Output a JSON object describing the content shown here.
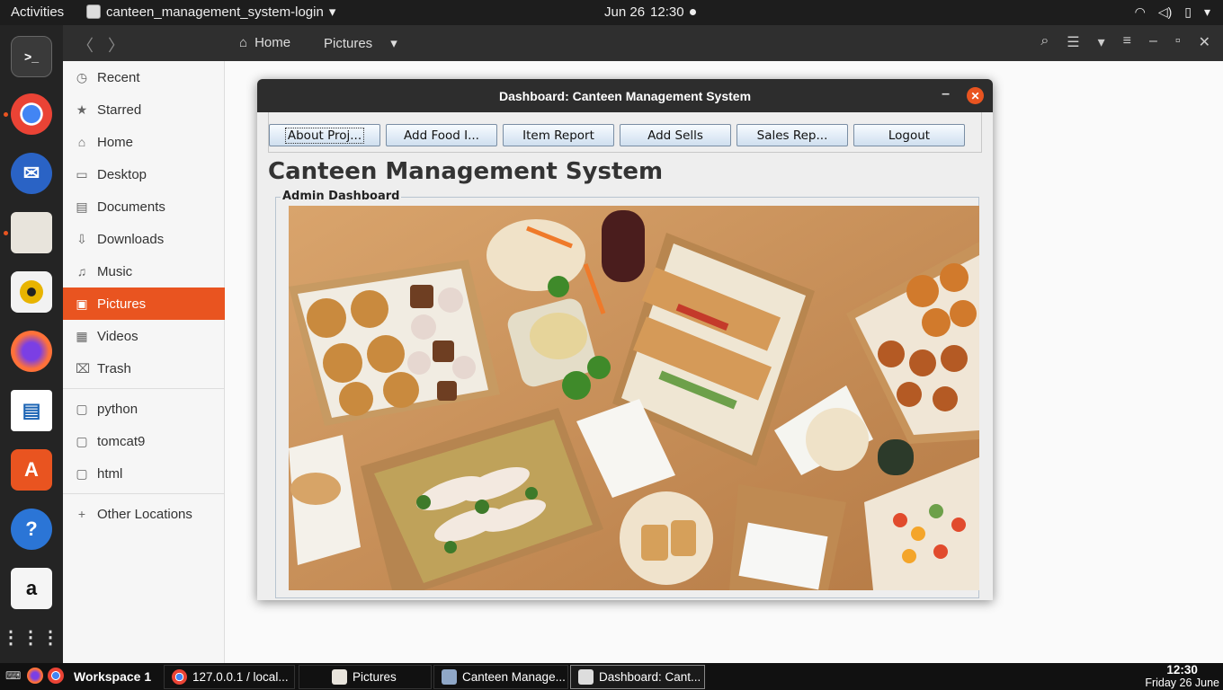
{
  "topbar": {
    "activities": "Activities",
    "app_name": "canteen_management_system-login",
    "date": "Jun 26",
    "time": "12:30"
  },
  "files": {
    "crumbs": [
      "Home",
      "Pictures"
    ],
    "sidebar": [
      {
        "label": "Recent",
        "icon": "clock-icon",
        "glyph": "◷"
      },
      {
        "label": "Starred",
        "icon": "star-icon",
        "glyph": "★"
      },
      {
        "label": "Home",
        "icon": "home-icon",
        "glyph": "⌂"
      },
      {
        "label": "Desktop",
        "icon": "desktop-icon",
        "glyph": "▭"
      },
      {
        "label": "Documents",
        "icon": "document-icon",
        "glyph": "▤"
      },
      {
        "label": "Downloads",
        "icon": "download-icon",
        "glyph": "⇩"
      },
      {
        "label": "Music",
        "icon": "music-icon",
        "glyph": "♫"
      },
      {
        "label": "Pictures",
        "icon": "picture-icon",
        "glyph": "▣",
        "active": true
      },
      {
        "label": "Videos",
        "icon": "video-icon",
        "glyph": "▦"
      },
      {
        "label": "Trash",
        "icon": "trash-icon",
        "glyph": "🗑"
      }
    ],
    "bookmarks": [
      {
        "label": "python",
        "icon": "folder-icon",
        "glyph": "▢"
      },
      {
        "label": "tomcat9",
        "icon": "folder-icon",
        "glyph": "▢"
      },
      {
        "label": "html",
        "icon": "folder-icon",
        "glyph": "▢"
      }
    ],
    "other": {
      "label": "Other Locations",
      "icon": "plus-icon",
      "glyph": "+"
    }
  },
  "dialog": {
    "title": "Dashboard: Canteen Management System",
    "buttons": [
      "About Proj...",
      "Add Food I...",
      "Item Report",
      "Add Sells",
      "Sales Rep...",
      "Logout"
    ],
    "heading": "Canteen Management System",
    "panel_legend": "Admin Dashboard",
    "image_alt": "food-platter-photo"
  },
  "taskbar": {
    "workspace": "Workspace 1",
    "tasks": [
      "127.0.0.1 / local...",
      "Pictures",
      "Canteen Manage...",
      "Dashboard: Cant..."
    ],
    "time": "12:30",
    "date": "Friday 26 June"
  },
  "colors": {
    "accent": "#e95420",
    "dark": "#2d2d2d"
  }
}
